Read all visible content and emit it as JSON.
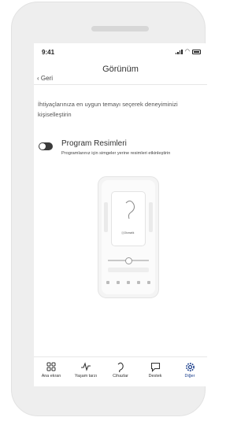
{
  "status_bar": {
    "time": "9:41"
  },
  "nav": {
    "back_label": "Geri",
    "title": "Görünüm"
  },
  "description": "İhtiyaçlarınıza en uygun temayı seçerek deneyiminizi kişiselleştirin",
  "option": {
    "title": "Program Resimleri",
    "subtitle": "Programlarınız için simgeler yerine resimleri etkinleştirin",
    "enabled": false
  },
  "preview": {
    "program_label": "Otomatik"
  },
  "tabbar": {
    "items": [
      {
        "label": "Ana ekran",
        "icon": "grid-icon"
      },
      {
        "label": "Yaşam tarzı",
        "icon": "activity-icon"
      },
      {
        "label": "Cihazlar",
        "icon": "hearing-aid-icon"
      },
      {
        "label": "Destek",
        "icon": "chat-icon"
      },
      {
        "label": "Diğer",
        "icon": "gear-icon",
        "active": true
      }
    ]
  },
  "colors": {
    "accent": "#1a3e8c",
    "toggle_off": "#3a3a3a"
  }
}
